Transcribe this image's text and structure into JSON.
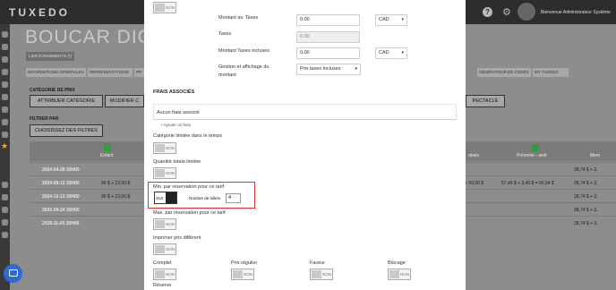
{
  "app": {
    "brand": "TUXEDO",
    "help_icon": "?",
    "username": "Bienvenue Administrateur Système"
  },
  "background": {
    "title": "BOUCAR DIOU",
    "events_button": "LIER ÉVÉNEMENTS (*)",
    "tabs": [
      {
        "label": "INFORMATIONS GÉNÉRALES"
      },
      {
        "label": "REPRÉSENTATIONS"
      },
      {
        "label": "PR"
      },
      {
        "label": "GÉNÉRATEUR DE CODES"
      },
      {
        "label": "MY TUXEDO"
      }
    ],
    "categories_title": "CATÉGORIE DE PRIX",
    "category_buttons": [
      "ATTRIBUER CATÉGORIE",
      "MODIFIER C",
      "PECTACLE"
    ],
    "filter_title": "FILTRER PAR",
    "filter_button": "CHOISISSEZ DES FILTRES",
    "columns": [
      "Enfant",
      "abais",
      "Prévente - web",
      "Mem"
    ],
    "rows": [
      {
        "date": "2024-04-28 20H00",
        "cells": [
          "",
          "",
          "",
          "28,74 $ + 3,"
        ]
      },
      {
        "date": "2024-09-13 20H00",
        "cells": [
          "00 $ + 22,00 $",
          "+ 50,00 $",
          "57,49 $ + 3,45 $ = 60,94 $",
          "28,74 $ + 3,"
        ]
      },
      {
        "date": "2024-10-13 20H00",
        "cells": [
          "00 $ + 22,00 $",
          "",
          "",
          "28,74 $ + 3,"
        ]
      },
      {
        "date": "2025-09-24 20H00",
        "cells": [
          "",
          "",
          "",
          "28,74 $ + 3,"
        ]
      },
      {
        "date": "2026-11-03 20H00",
        "cells": [
          "",
          "",
          "",
          "28,74 $ + 3,"
        ]
      }
    ]
  },
  "modal": {
    "toggle_off_label": "NON",
    "montant_av_taxes": {
      "label": "Montant av. Taxes",
      "value": "0.00",
      "currency": "CAD"
    },
    "taxes": {
      "label": "Taxes",
      "value": "0.00"
    },
    "montant_taxes_incluses": {
      "label": "Montant Taxes incluses",
      "value": "0.00",
      "currency": "CAD"
    },
    "gestion": {
      "label_line1": "Gestion et affichage du",
      "label_line2": "montant",
      "value": "Prix taxes incluses"
    },
    "frais_title": "FRAIS ASSOCIÉS",
    "frais_empty": "Aucun frais associé",
    "add_frais": "+ Ajouter un frais",
    "categorie_limitee": "Catégorie limitée dans le temps",
    "quantite_totale": "Quantité totale limitée",
    "min_reservation": {
      "label": "Min. par réservation pour ce tarif",
      "toggle": "OUI",
      "count_label": "Nombre de billets",
      "count_value": "4"
    },
    "max_reservation": "Max. par réservation pour ce tarif",
    "imprimer_prix": "Imprimer prix différent",
    "complet": "Complet",
    "prix_regulier": "Prix régulier",
    "faveur": "Faveur",
    "blocage": "Blocage",
    "reserve": "Réserve"
  }
}
